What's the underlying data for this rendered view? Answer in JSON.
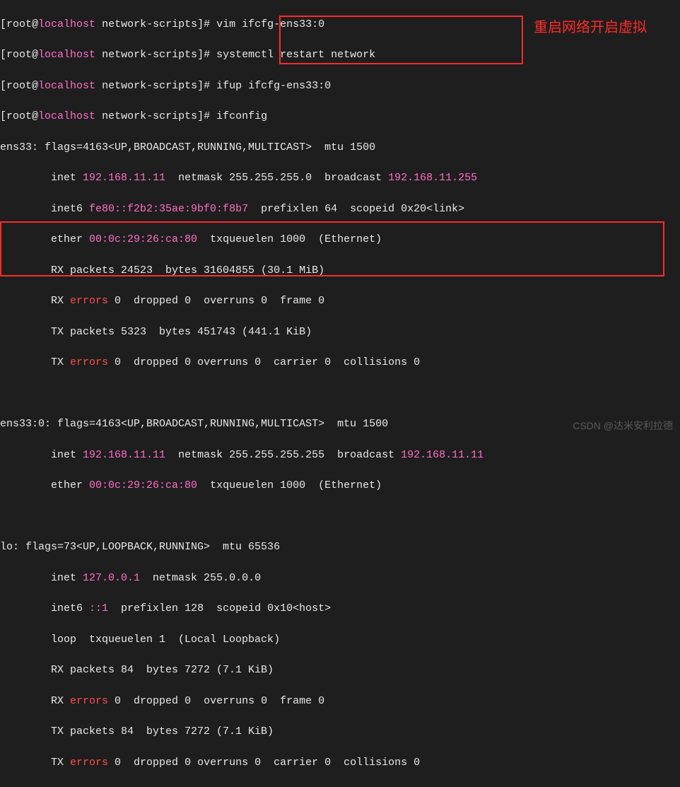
{
  "annotation": "重启网络开启虚拟",
  "watermark": "CSDN @达米安利拉德",
  "prompt": {
    "bracket_open": "[",
    "user": "root",
    "at": "@",
    "host": "localhost",
    "cwd": " network-scripts",
    "bracket_close": "]# "
  },
  "cmds": {
    "c1": "vim ifcfg-ens33:0",
    "c2": "systemctl restart network",
    "c3": "ifup ifcfg-ens33:0",
    "c4": "ifconfig"
  },
  "ens33": {
    "header": "ens33: flags=4163<UP,BROADCAST,RUNNING,MULTICAST>  mtu 1500",
    "inet_a": "        inet ",
    "inet_ip": "192.168.11.11",
    "inet_b": "  netmask 255.255.255.0  broadcast ",
    "inet_bc": "192.168.11.255",
    "inet6_a": "        inet6 ",
    "inet6_ip": "fe80::f2b2:35ae:9bf0:f8b7",
    "inet6_b": "  prefixlen 64  scopeid 0x20<link>",
    "ether_a": "        ether ",
    "ether_mac": "00:0c:29:26:ca:80",
    "ether_b": "  txqueuelen 1000  (Ethernet)",
    "rx1": "        RX packets 24523  bytes 31604855 (30.1 MiB)",
    "rx2a": "        RX ",
    "rx2err": "errors",
    "rx2b": " 0  dropped 0  overruns 0  frame 0",
    "tx1": "        TX packets 5323  bytes 451743 (441.1 KiB)",
    "tx2a": "        TX ",
    "tx2err": "errors",
    "tx2b": " 0  dropped 0 overruns 0  carrier 0  collisions 0"
  },
  "ens33_0": {
    "header": "ens33:0: flags=4163<UP,BROADCAST,RUNNING,MULTICAST>  mtu 1500",
    "inet_a": "        inet ",
    "inet_ip": "192.168.11.11",
    "inet_b": "  netmask 255.255.255.255  broadcast ",
    "inet_bc": "192.168.11.11",
    "ether_a": "        ether ",
    "ether_mac": "00:0c:29:26:ca:80",
    "ether_b": "  txqueuelen 1000  (Ethernet)"
  },
  "lo": {
    "header": "lo: flags=73<UP,LOOPBACK,RUNNING>  mtu 65536",
    "inet_a": "        inet ",
    "inet_ip": "127.0.0.1",
    "inet_b": "  netmask 255.0.0.0",
    "inet6_a": "        inet6 ",
    "inet6_ip": "::1",
    "inet6_b": "  prefixlen 128  scopeid 0x10<host>",
    "loop": "        loop  txqueuelen 1  (Local Loopback)",
    "rx1": "        RX packets 84  bytes 7272 (7.1 KiB)",
    "rx2a": "        RX ",
    "rx2err": "errors",
    "rx2b": " 0  dropped 0  overruns 0  frame 0",
    "tx1": "        TX packets 84  bytes 7272 (7.1 KiB)",
    "tx2a": "        TX ",
    "tx2err": "errors",
    "tx2b": " 0  dropped 0 overruns 0  carrier 0  collisions 0"
  }
}
